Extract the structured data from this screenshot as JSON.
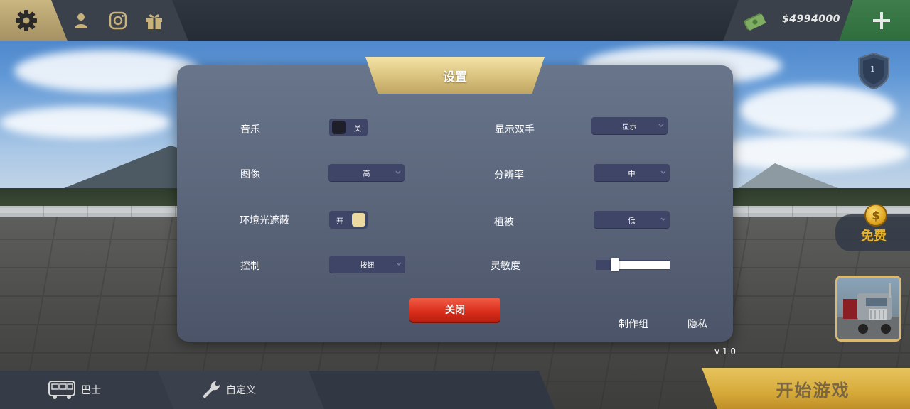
{
  "header": {
    "money": "$4994000"
  },
  "dialog": {
    "title": "设置",
    "left": [
      {
        "label": "音乐",
        "control": "toggle",
        "value": "关",
        "on": false
      },
      {
        "label": "图像",
        "control": "select",
        "value": "高"
      },
      {
        "label": "环境光遮蔽",
        "control": "toggle",
        "value": "开",
        "on": true
      },
      {
        "label": "控制",
        "control": "select",
        "value": "按钮"
      }
    ],
    "right": [
      {
        "label": "显示双手",
        "control": "select",
        "value": "显示"
      },
      {
        "label": "分辨率",
        "control": "select",
        "value": "中"
      },
      {
        "label": "植被",
        "control": "select",
        "value": "低"
      },
      {
        "label": "灵敏度",
        "control": "slider",
        "level": 0.25
      }
    ],
    "close_label": "关闭",
    "credits_label": "制作组",
    "privacy_label": "隐私"
  },
  "version": "v 1.0",
  "right_panel": {
    "rank": "1",
    "coin_symbol": "$",
    "free_label": "免费"
  },
  "bottom": {
    "bus_label": "巴士",
    "custom_label": "自定义",
    "start_label": "开始游戏"
  },
  "colors": {
    "dialog_bg": "#5e697f",
    "control_bg": "#3f4567",
    "accent_gold": "#d9c27d",
    "close_red": "#d92d1b",
    "toggle_off_knob": "#1f1f29",
    "toggle_on_knob": "#ecd9a0"
  },
  "icons": {
    "settings": "gear-icon",
    "profile": "user-icon",
    "instagram": "instagram-icon",
    "gift": "gift-icon",
    "money": "cash-icon",
    "plus": "plus-icon",
    "bus": "bus-icon",
    "customize": "wrench-icon"
  }
}
